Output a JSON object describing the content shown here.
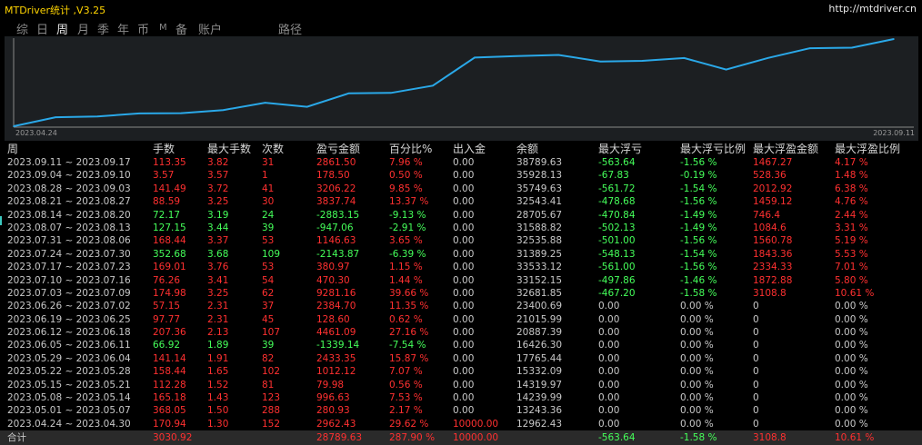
{
  "app": {
    "title": "MTDriver统计 ,V3.25",
    "url": "http://mtdriver.cn"
  },
  "tabs": [
    {
      "label": "综",
      "active": false,
      "small": false
    },
    {
      "label": "日",
      "active": false,
      "small": false
    },
    {
      "label": "周",
      "active": true,
      "small": false
    },
    {
      "label": "月",
      "active": false,
      "small": false
    },
    {
      "label": "季",
      "active": false,
      "small": false
    },
    {
      "label": "年",
      "active": false,
      "small": false
    },
    {
      "label": "币",
      "active": false,
      "small": false
    },
    {
      "label": "M",
      "active": false,
      "small": true
    },
    {
      "label": "备",
      "active": false,
      "small": false
    },
    {
      "label": "账户",
      "active": false,
      "small": false
    },
    {
      "label": "路径",
      "active": false,
      "small": false
    }
  ],
  "chart_data": {
    "type": "line",
    "x_start_label": "2023.04.24",
    "x_end_label": "2023.09.11",
    "series": [
      {
        "color": "#2aa8e8",
        "values": [
          10000.0,
          12962.43,
          13243.36,
          14239.99,
          14319.97,
          15332.09,
          17765.44,
          16426.3,
          20887.39,
          21015.99,
          23400.69,
          32681.85,
          33152.15,
          33533.12,
          31389.25,
          31588.82,
          32535.88,
          28705.67,
          32543.41,
          35749.63,
          35928.13,
          38789.63
        ]
      }
    ]
  },
  "table": {
    "headers": [
      "周",
      "手数",
      "最大手数",
      "次数",
      "盈亏金额",
      "百分比%",
      "出入金",
      "余额",
      "最大浮亏",
      "最大浮亏比例",
      "最大浮盈金额",
      "最大浮盈比例"
    ],
    "rows": [
      {
        "color": "red",
        "cells": [
          "2023.09.11 ~ 2023.09.17",
          "113.35",
          "3.82",
          "31",
          "2861.50",
          "7.96 %",
          "0.00",
          "38789.63",
          "-563.64",
          "-1.56 %",
          "1467.27",
          "4.17 %"
        ]
      },
      {
        "color": "red",
        "cells": [
          "2023.09.04 ~ 2023.09.10",
          "3.57",
          "3.57",
          "1",
          "178.50",
          "0.50 %",
          "0.00",
          "35928.13",
          "-67.83",
          "-0.19 %",
          "528.36",
          "1.48 %"
        ]
      },
      {
        "color": "red",
        "cells": [
          "2023.08.28 ~ 2023.09.03",
          "141.49",
          "3.72",
          "41",
          "3206.22",
          "9.85 %",
          "0.00",
          "35749.63",
          "-561.72",
          "-1.54 %",
          "2012.92",
          "6.38 %"
        ]
      },
      {
        "color": "red",
        "cells": [
          "2023.08.21 ~ 2023.08.27",
          "88.59",
          "3.25",
          "30",
          "3837.74",
          "13.37 %",
          "0.00",
          "32543.41",
          "-478.68",
          "-1.56 %",
          "1459.12",
          "4.76 %"
        ]
      },
      {
        "color": "green",
        "cells": [
          "2023.08.14 ~ 2023.08.20",
          "72.17",
          "3.19",
          "24",
          "-2883.15",
          "-9.13 %",
          "0.00",
          "28705.67",
          "-470.84",
          "-1.49 %",
          "746.4",
          "2.44 %"
        ]
      },
      {
        "color": "green",
        "cells": [
          "2023.08.07 ~ 2023.08.13",
          "127.15",
          "3.44",
          "39",
          "-947.06",
          "-2.91 %",
          "0.00",
          "31588.82",
          "-502.13",
          "-1.49 %",
          "1084.6",
          "3.31 %"
        ]
      },
      {
        "color": "red",
        "cells": [
          "2023.07.31 ~ 2023.08.06",
          "168.44",
          "3.37",
          "53",
          "1146.63",
          "3.65 %",
          "0.00",
          "32535.88",
          "-501.00",
          "-1.56 %",
          "1560.78",
          "5.19 %"
        ]
      },
      {
        "color": "green",
        "cells": [
          "2023.07.24 ~ 2023.07.30",
          "352.68",
          "3.68",
          "109",
          "-2143.87",
          "-6.39 %",
          "0.00",
          "31389.25",
          "-548.13",
          "-1.54 %",
          "1843.36",
          "5.53 %"
        ]
      },
      {
        "color": "red",
        "cells": [
          "2023.07.17 ~ 2023.07.23",
          "169.01",
          "3.76",
          "53",
          "380.97",
          "1.15 %",
          "0.00",
          "33533.12",
          "-561.00",
          "-1.56 %",
          "2334.33",
          "7.01 %"
        ]
      },
      {
        "color": "red",
        "cells": [
          "2023.07.10 ~ 2023.07.16",
          "76.26",
          "3.41",
          "54",
          "470.30",
          "1.44 %",
          "0.00",
          "33152.15",
          "-497.86",
          "-1.46 %",
          "1872.88",
          "5.80 %"
        ]
      },
      {
        "color": "red",
        "cells": [
          "2023.07.03 ~ 2023.07.09",
          "174.98",
          "3.25",
          "62",
          "9281.16",
          "39.66 %",
          "0.00",
          "32681.85",
          "-467.20",
          "-1.58 %",
          "3108.8",
          "10.61 %"
        ]
      },
      {
        "color": "red",
        "cells": [
          "2023.06.26 ~ 2023.07.02",
          "57.15",
          "2.31",
          "37",
          "2384.70",
          "11.35 %",
          "0.00",
          "23400.69",
          "0.00",
          "0.00 %",
          "0",
          "0.00 %"
        ]
      },
      {
        "color": "red",
        "cells": [
          "2023.06.19 ~ 2023.06.25",
          "97.77",
          "2.31",
          "45",
          "128.60",
          "0.62 %",
          "0.00",
          "21015.99",
          "0.00",
          "0.00 %",
          "0",
          "0.00 %"
        ]
      },
      {
        "color": "red",
        "cells": [
          "2023.06.12 ~ 2023.06.18",
          "207.36",
          "2.13",
          "107",
          "4461.09",
          "27.16 %",
          "0.00",
          "20887.39",
          "0.00",
          "0.00 %",
          "0",
          "0.00 %"
        ]
      },
      {
        "color": "green",
        "cells": [
          "2023.06.05 ~ 2023.06.11",
          "66.92",
          "1.89",
          "39",
          "-1339.14",
          "-7.54 %",
          "0.00",
          "16426.30",
          "0.00",
          "0.00 %",
          "0",
          "0.00 %"
        ]
      },
      {
        "color": "red",
        "cells": [
          "2023.05.29 ~ 2023.06.04",
          "141.14",
          "1.91",
          "82",
          "2433.35",
          "15.87 %",
          "0.00",
          "17765.44",
          "0.00",
          "0.00 %",
          "0",
          "0.00 %"
        ]
      },
      {
        "color": "red",
        "cells": [
          "2023.05.22 ~ 2023.05.28",
          "158.44",
          "1.65",
          "102",
          "1012.12",
          "7.07 %",
          "0.00",
          "15332.09",
          "0.00",
          "0.00 %",
          "0",
          "0.00 %"
        ]
      },
      {
        "color": "red",
        "cells": [
          "2023.05.15 ~ 2023.05.21",
          "112.28",
          "1.52",
          "81",
          "79.98",
          "0.56 %",
          "0.00",
          "14319.97",
          "0.00",
          "0.00 %",
          "0",
          "0.00 %"
        ]
      },
      {
        "color": "red",
        "cells": [
          "2023.05.08 ~ 2023.05.14",
          "165.18",
          "1.43",
          "123",
          "996.63",
          "7.53 %",
          "0.00",
          "14239.99",
          "0.00",
          "0.00 %",
          "0",
          "0.00 %"
        ]
      },
      {
        "color": "red",
        "cells": [
          "2023.05.01 ~ 2023.05.07",
          "368.05",
          "1.50",
          "288",
          "280.93",
          "2.17 %",
          "0.00",
          "13243.36",
          "0.00",
          "0.00 %",
          "0",
          "0.00 %"
        ]
      },
      {
        "color": "red",
        "cells": [
          "2023.04.24 ~ 2023.04.30",
          "170.94",
          "1.30",
          "152",
          "2962.43",
          "29.62 %",
          "10000.00",
          "12962.43",
          "0.00",
          "0.00 %",
          "0",
          "0.00 %"
        ]
      }
    ],
    "total": {
      "cells": [
        "合计",
        "3030.92",
        "",
        "",
        "28789.63",
        "287.90 %",
        "10000.00",
        "",
        "-563.64",
        "-1.58 %",
        "3108.8",
        "10.61 %"
      ],
      "colors": [
        "gray",
        "red",
        "",
        "",
        "red",
        "red",
        "red",
        "",
        "green",
        "green",
        "red",
        "red"
      ]
    }
  }
}
